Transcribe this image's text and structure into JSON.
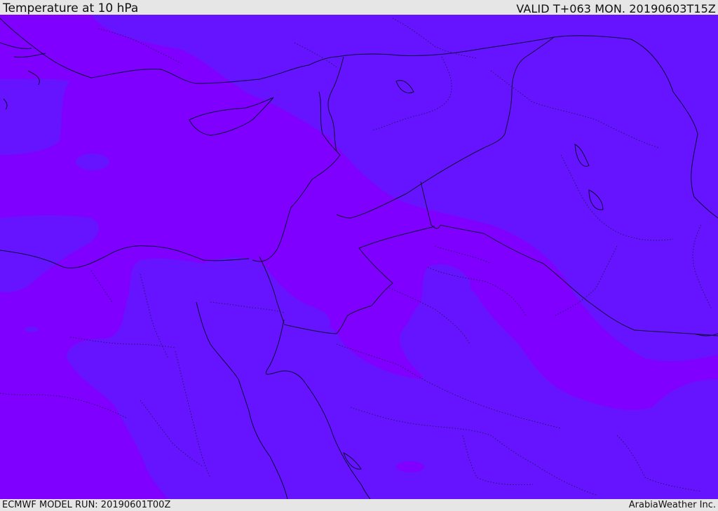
{
  "header": {
    "title": "Temperature at 10 hPa",
    "valid_label": "VALID T+063 MON. 20190603T15Z"
  },
  "footer": {
    "model_run": "ECMWF MODEL RUN: 20190601T00Z",
    "credit": "ArabiaWeather Inc."
  },
  "map": {
    "colors": {
      "warmer_band": "#8000ff",
      "cooler_band": "#6614ff",
      "coastline": "#0a0a3a",
      "border": "#111133"
    }
  }
}
